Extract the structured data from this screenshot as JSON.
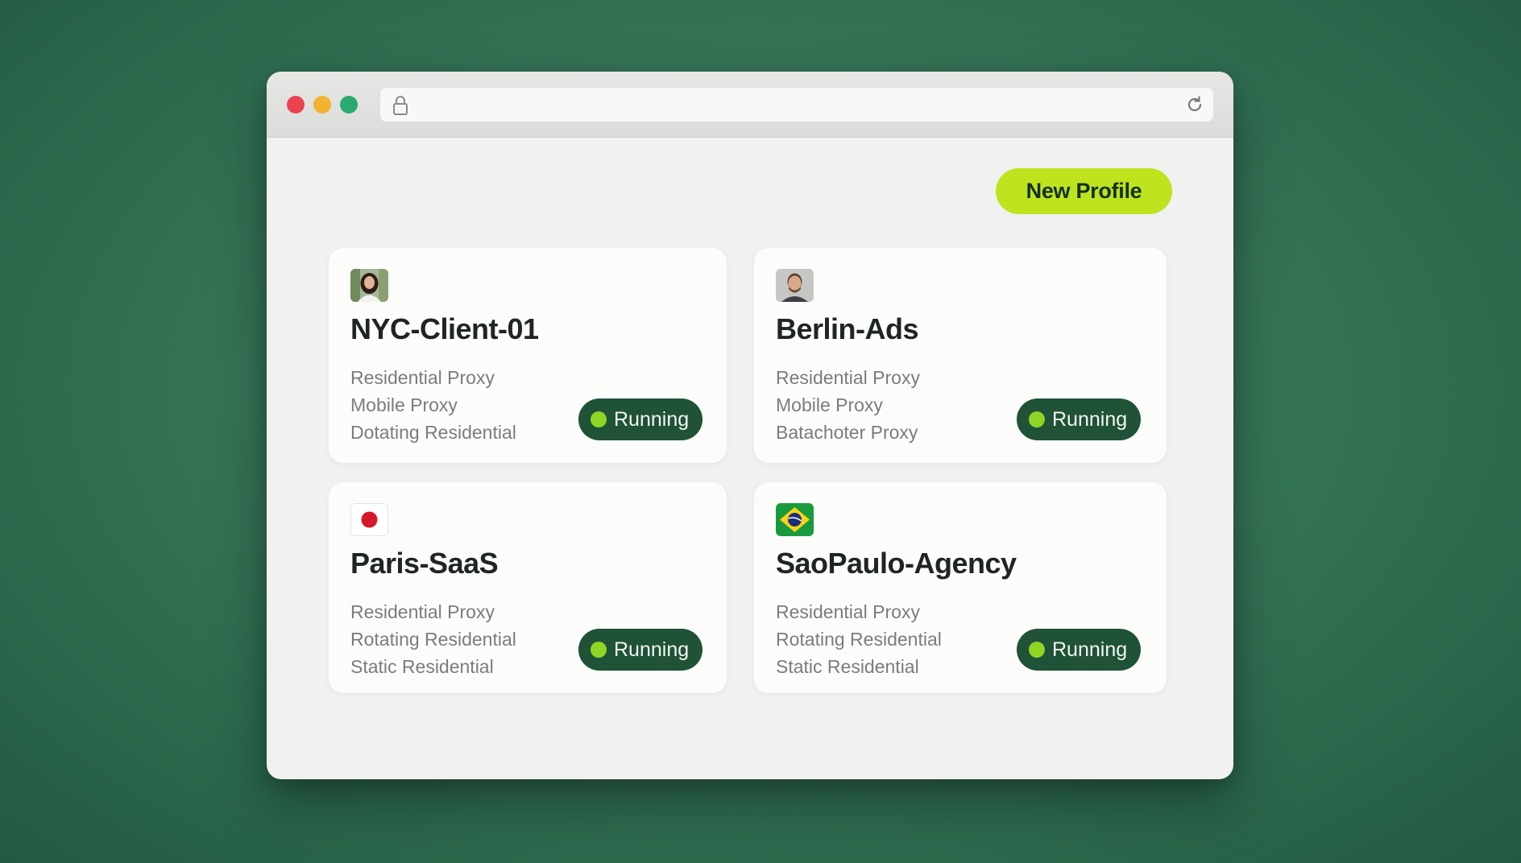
{
  "colors": {
    "accent": "#bde41f",
    "status_bg": "#1f5236",
    "status_dot": "#8fd624"
  },
  "toolbar": {
    "new_profile_label": "New Profile"
  },
  "profiles": [
    {
      "name": "NYC-Client-01",
      "icon": "woman-avatar-icon",
      "features": [
        "Residential Proxy",
        "Mobile Proxy",
        "Dotating Residential"
      ],
      "status": "Running"
    },
    {
      "name": "Berlin-Ads",
      "icon": "man-avatar-icon",
      "features": [
        "Residential Proxy",
        "Mobile Proxy",
        "Batachoter Proxy"
      ],
      "status": "Running"
    },
    {
      "name": "Paris-SaaS",
      "icon": "japan-flag-icon",
      "features": [
        "Residential Proxy",
        "Rotating Residential",
        "Static Residential"
      ],
      "status": "Running"
    },
    {
      "name": "SaoPaulo-Agency",
      "icon": "brazil-flag-icon",
      "features": [
        "Residential Proxy",
        "Rotating Residential",
        "Static Residential"
      ],
      "status": "Running"
    }
  ]
}
